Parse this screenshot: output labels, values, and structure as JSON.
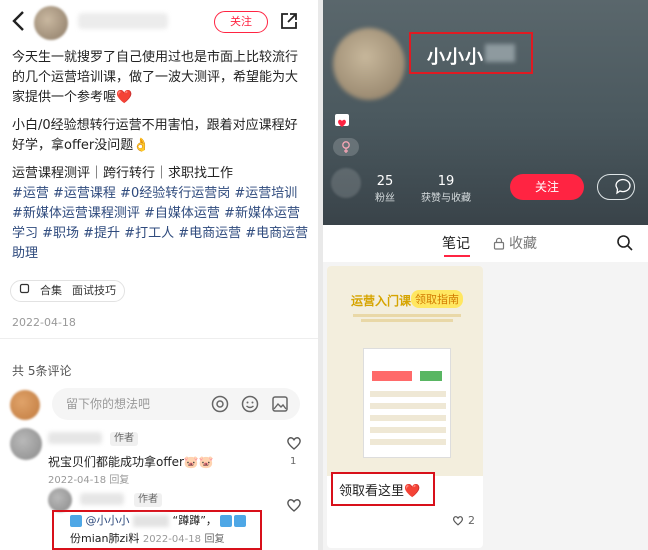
{
  "post": {
    "follow_label": "关注",
    "paragraph1": "今天生一就搜罗了自己使用过也是市面上比较流行的几个运营培训课，做了一波大测评，希望能为大家提供一个参考喔❤️",
    "paragraph2": "小白/0经验想转行运营不用害怕，跟着对应课程好好学，拿offer没问题👌",
    "meta_line": "运营课程测评｜跨行转行｜求职找工作",
    "hashtags": "#运营 #运营课程 #0经验转行运营岗 #运营培训 #新媒体运营课程测评 #自媒体运营 #新媒体运营学习 #职场 #提升 #打工人 #电商运营 #电商运营助理",
    "tag_collection": "合集",
    "tag_topic": "面试技巧",
    "date": "2022-04-18"
  },
  "comments": {
    "count_label": "共 5条评论",
    "input_placeholder": "留下你的想法吧",
    "first": {
      "author_tag": "作者",
      "text": "祝宝贝们都能成功拿offer🐷🐷",
      "date": "2022-04-18",
      "reply_label": "回复",
      "likes": "1"
    },
    "second": {
      "author_tag": "作者",
      "line1_mention": "@小小小",
      "line1_text": "“蹲蹲”，",
      "line1_tail": "",
      "line2_text": "份mian肺zi料",
      "date": "2022-04-18",
      "reply_label": "回复"
    }
  },
  "profile": {
    "name": "小小小",
    "fans_count": "25",
    "fans_label": "粉丝",
    "likes_count": "19",
    "likes_label": "获赞与收藏",
    "follow_label": "关注"
  },
  "tabs": {
    "notes": "笔记",
    "collect": "收藏"
  },
  "card": {
    "cover_title": "运营入门课",
    "cover_badge": "领取指南",
    "caption": "领取看这里❤️",
    "likes": "2"
  },
  "colors": {
    "accent": "#ff2442",
    "highlight_box": "#d8101a",
    "hashtag": "#2e4a7d"
  }
}
